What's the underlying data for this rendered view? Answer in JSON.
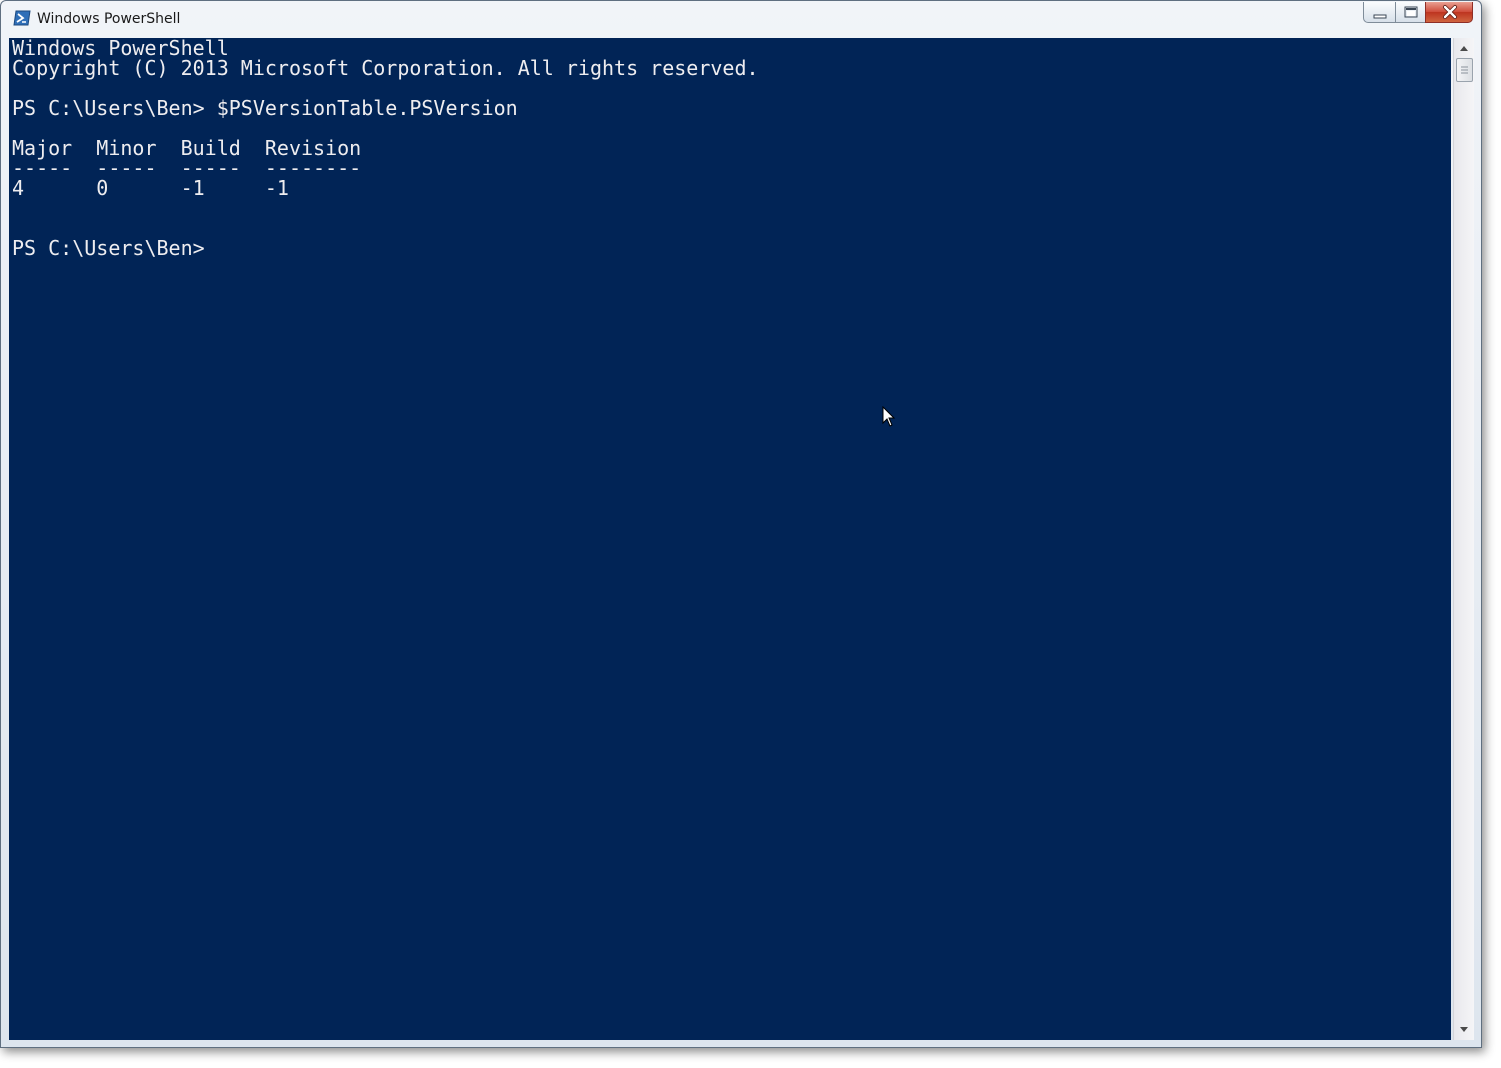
{
  "window": {
    "title": "Windows PowerShell",
    "app_icon": "powershell-icon",
    "controls": {
      "minimize_icon": "minimize-icon",
      "maximize_icon": "maximize-icon",
      "close_icon": "close-icon"
    }
  },
  "console": {
    "background_color": "#012456",
    "text_color": "#eeedf0",
    "lines": [
      "Windows PowerShell",
      "Copyright (C) 2013 Microsoft Corporation. All rights reserved.",
      "",
      "PS C:\\Users\\Ben> $PSVersionTable.PSVersion",
      "",
      "Major  Minor  Build  Revision",
      "-----  -----  -----  --------",
      "4      0      -1     -1",
      "",
      "",
      "PS C:\\Users\\Ben>"
    ]
  },
  "scrollbar": {
    "up_icon": "scroll-up-arrow-icon",
    "down_icon": "scroll-down-arrow-icon"
  },
  "pointer": {
    "icon": "mouse-pointer-icon"
  }
}
